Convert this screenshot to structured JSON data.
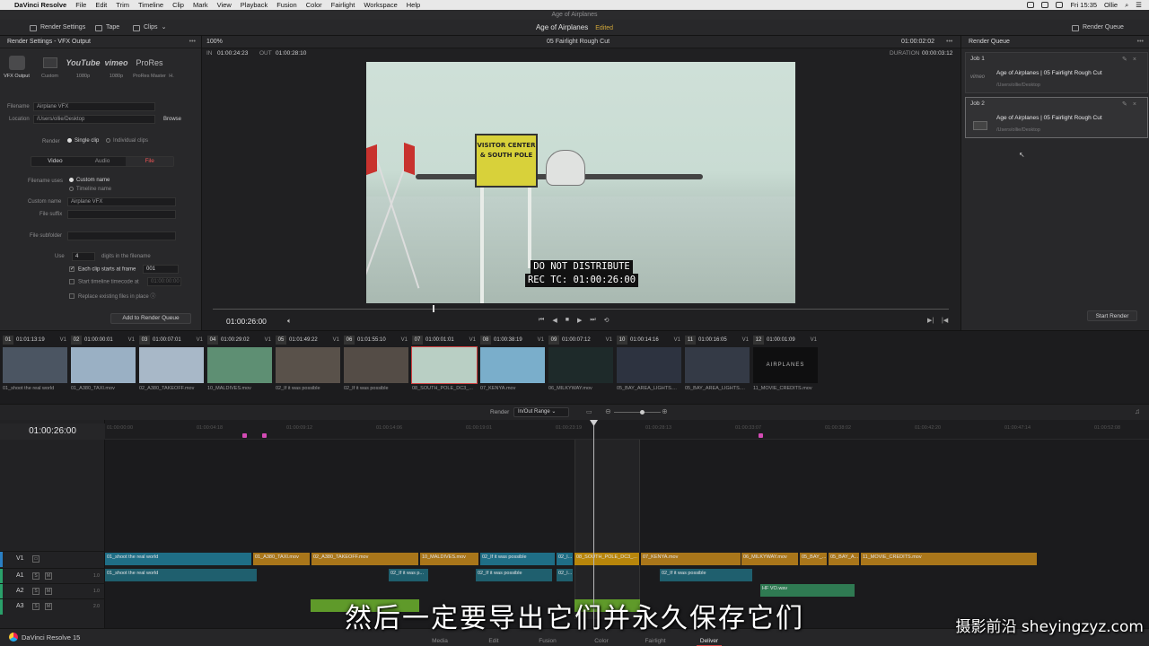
{
  "menubar": {
    "app": "DaVinci Resolve",
    "items": [
      "File",
      "Edit",
      "Trim",
      "Timeline",
      "Clip",
      "Mark",
      "View",
      "Playback",
      "Fusion",
      "Color",
      "Fairlight",
      "Workspace",
      "Help"
    ],
    "clock": "Fri 15:35",
    "user": "Ollie"
  },
  "window": {
    "title": "Age of Airplanes"
  },
  "toolbar": {
    "render_settings": "Render Settings",
    "tape": "Tape",
    "clips": "Clips",
    "project": "Age of Airplanes",
    "edited": "Edited",
    "render_queue": "Render Queue"
  },
  "render_settings": {
    "title": "Render Settings - VFX Output",
    "presets": [
      {
        "icon": "",
        "label": "VFX Output"
      },
      {
        "icon": "",
        "label": "Custom"
      },
      {
        "icon": "YouTube",
        "label": "1080p"
      },
      {
        "icon": "vimeo",
        "label": "1080p"
      },
      {
        "icon": "ProRes",
        "label": "ProRes Master"
      },
      {
        "icon": "",
        "label": "H."
      }
    ],
    "filename_label": "Filename",
    "filename": "Airplane VFX",
    "location_label": "Location",
    "location": "/Users/ollie/Desktop",
    "browse": "Browse",
    "render_label": "Render",
    "single_clip": "Single clip",
    "individual_clips": "Individual clips",
    "tab_video": "Video",
    "tab_audio": "Audio",
    "tab_file": "File",
    "filename_uses_label": "Filename uses",
    "custom_name_opt": "Custom name",
    "timeline_name_opt": "Timeline name",
    "custom_name_label": "Custom name",
    "custom_name": "Airplane VFX",
    "file_suffix_label": "File suffix",
    "file_subfolder_label": "File subfolder",
    "use_label": "Use",
    "digits": "4",
    "digits_text": "digits in the filename",
    "each_clip_label": "Each clip starts at frame",
    "each_clip_value": "001",
    "start_tc_label": "Start timeline timecode at",
    "start_tc_value": "01:00:00:00",
    "replace_label": "Replace existing files in place",
    "add_to_queue": "Add to Render Queue"
  },
  "viewer": {
    "zoom": "100%",
    "clip_title": "05 Fairlight Rough Cut",
    "header_tc": "01:00:02:02",
    "in_label": "IN",
    "in_tc": "01:00:24:23",
    "out_label": "OUT",
    "out_tc": "01:00:28:10",
    "duration_label": "DURATION",
    "duration": "00:00:03:12",
    "burnin_line1": "DO NOT DISTRIBUTE",
    "burnin_line2": "REC TC: 01:00:26:00",
    "sign_text": "VISITOR CENTER & SOUTH POLE",
    "timecode": "01:00:26:00",
    "progress": 0.3
  },
  "queue": {
    "title": "Render Queue",
    "jobs": [
      {
        "name": "Job 1",
        "title": "Age of Airplanes | 05 Fairlight Rough Cut",
        "path": "/Users/ollie/Desktop",
        "thumb": "vimeo"
      },
      {
        "name": "Job 2",
        "title": "Age of Airplanes | 05 Fairlight Rough Cut",
        "path": "/Users/ollie/Desktop",
        "thumb": ""
      }
    ],
    "start_render": "Start Render"
  },
  "clips": [
    {
      "num": "01",
      "tc": "01:01:13:19",
      "track": "V1",
      "name": "01_shoot the real world",
      "color": "#4b5562"
    },
    {
      "num": "02",
      "tc": "01:00:00:01",
      "track": "V1",
      "name": "01_A380_TAXI.mov",
      "color": "#9ab0c4"
    },
    {
      "num": "03",
      "tc": "01:00:07:01",
      "track": "V1",
      "name": "02_A380_TAKEOFF.mov",
      "color": "#a8b8c8"
    },
    {
      "num": "04",
      "tc": "01:00:29:02",
      "track": "V1",
      "name": "10_MALDIVES.mov",
      "color": "#5e8f73"
    },
    {
      "num": "05",
      "tc": "01:01:49:22",
      "track": "V1",
      "name": "02_If it was possible",
      "color": "#59514a"
    },
    {
      "num": "06",
      "tc": "01:01:55:10",
      "track": "V1",
      "name": "02_If it was possible",
      "color": "#544c46"
    },
    {
      "num": "07",
      "tc": "01:00:01:01",
      "track": "V1",
      "name": "08_SOUTH_POLE_DC3_...",
      "color": "#b9cfc4"
    },
    {
      "num": "08",
      "tc": "01:00:38:19",
      "track": "V1",
      "name": "07_KENYA.mov",
      "color": "#7aaecb"
    },
    {
      "num": "09",
      "tc": "01:00:07:12",
      "track": "V1",
      "name": "06_MILKYWAY.mov",
      "color": "#1e2a2a"
    },
    {
      "num": "10",
      "tc": "01:00:14:16",
      "track": "V1",
      "name": "05_BAY_AREA_LIGHTS....",
      "color": "#2d3340"
    },
    {
      "num": "11",
      "tc": "01:00:16:05",
      "track": "V1",
      "name": "05_BAY_AREA_LIGHTS....",
      "color": "#343a46"
    },
    {
      "num": "12",
      "tc": "01:00:01:09",
      "track": "V1",
      "name": "11_MOVIE_CREDITS.mov",
      "color": "#0f0f10",
      "thumb_text": "AIRPLANES"
    }
  ],
  "render_bar": {
    "label": "Render",
    "value": "In/Out Range"
  },
  "timeline": {
    "timecode": "01:00:26:00",
    "ruler": [
      "01:00:00:00",
      "01:00:04:18",
      "01:00:09:12",
      "01:00:14:06",
      "01:00:19:01",
      "01:00:23:19",
      "01:00:28:13",
      "01:00:33:07",
      "01:00:38:02",
      "01:00:42:20",
      "01:00:47:14",
      "01:00:52:08"
    ],
    "tracks": [
      {
        "name": "V1",
        "vol": "",
        "barcolor": "#2a7fc4"
      },
      {
        "name": "A1",
        "vol": "1.0",
        "barcolor": "#2aa06a"
      },
      {
        "name": "A2",
        "vol": "1.0",
        "barcolor": "#2aa06a"
      },
      {
        "name": "A3",
        "vol": "2.0",
        "barcolor": "#2aa06a"
      }
    ],
    "v1": [
      "01_shoot the real world",
      "01_A380_TAXI.mov",
      "02_A380_TAKEOFF.mov",
      "10_MALDIVES.mov",
      "02_If it was possible",
      "02_I...",
      "08_SOUTH_POLE_DC3_...",
      "07_KENYA.mov",
      "06_MILKYWAY.mov",
      "05_BAY_...",
      "05_BAY_A...",
      "11_MOVIE_CREDITS.mov"
    ],
    "a1": [
      "01_shoot the real world",
      "02_If it was p...",
      "02_If it was possible",
      "02_I...",
      "02_If it was possible"
    ],
    "a2": [
      "HF VO.wav"
    ]
  },
  "pages": {
    "brand": "DaVinci Resolve 15",
    "items": [
      "Media",
      "Edit",
      "Fusion",
      "Color",
      "Fairlight",
      "Deliver"
    ]
  },
  "subtitle": "然后一定要导出它们并永久保存它们",
  "watermark": "摄影前沿 sheyingzyz.com"
}
